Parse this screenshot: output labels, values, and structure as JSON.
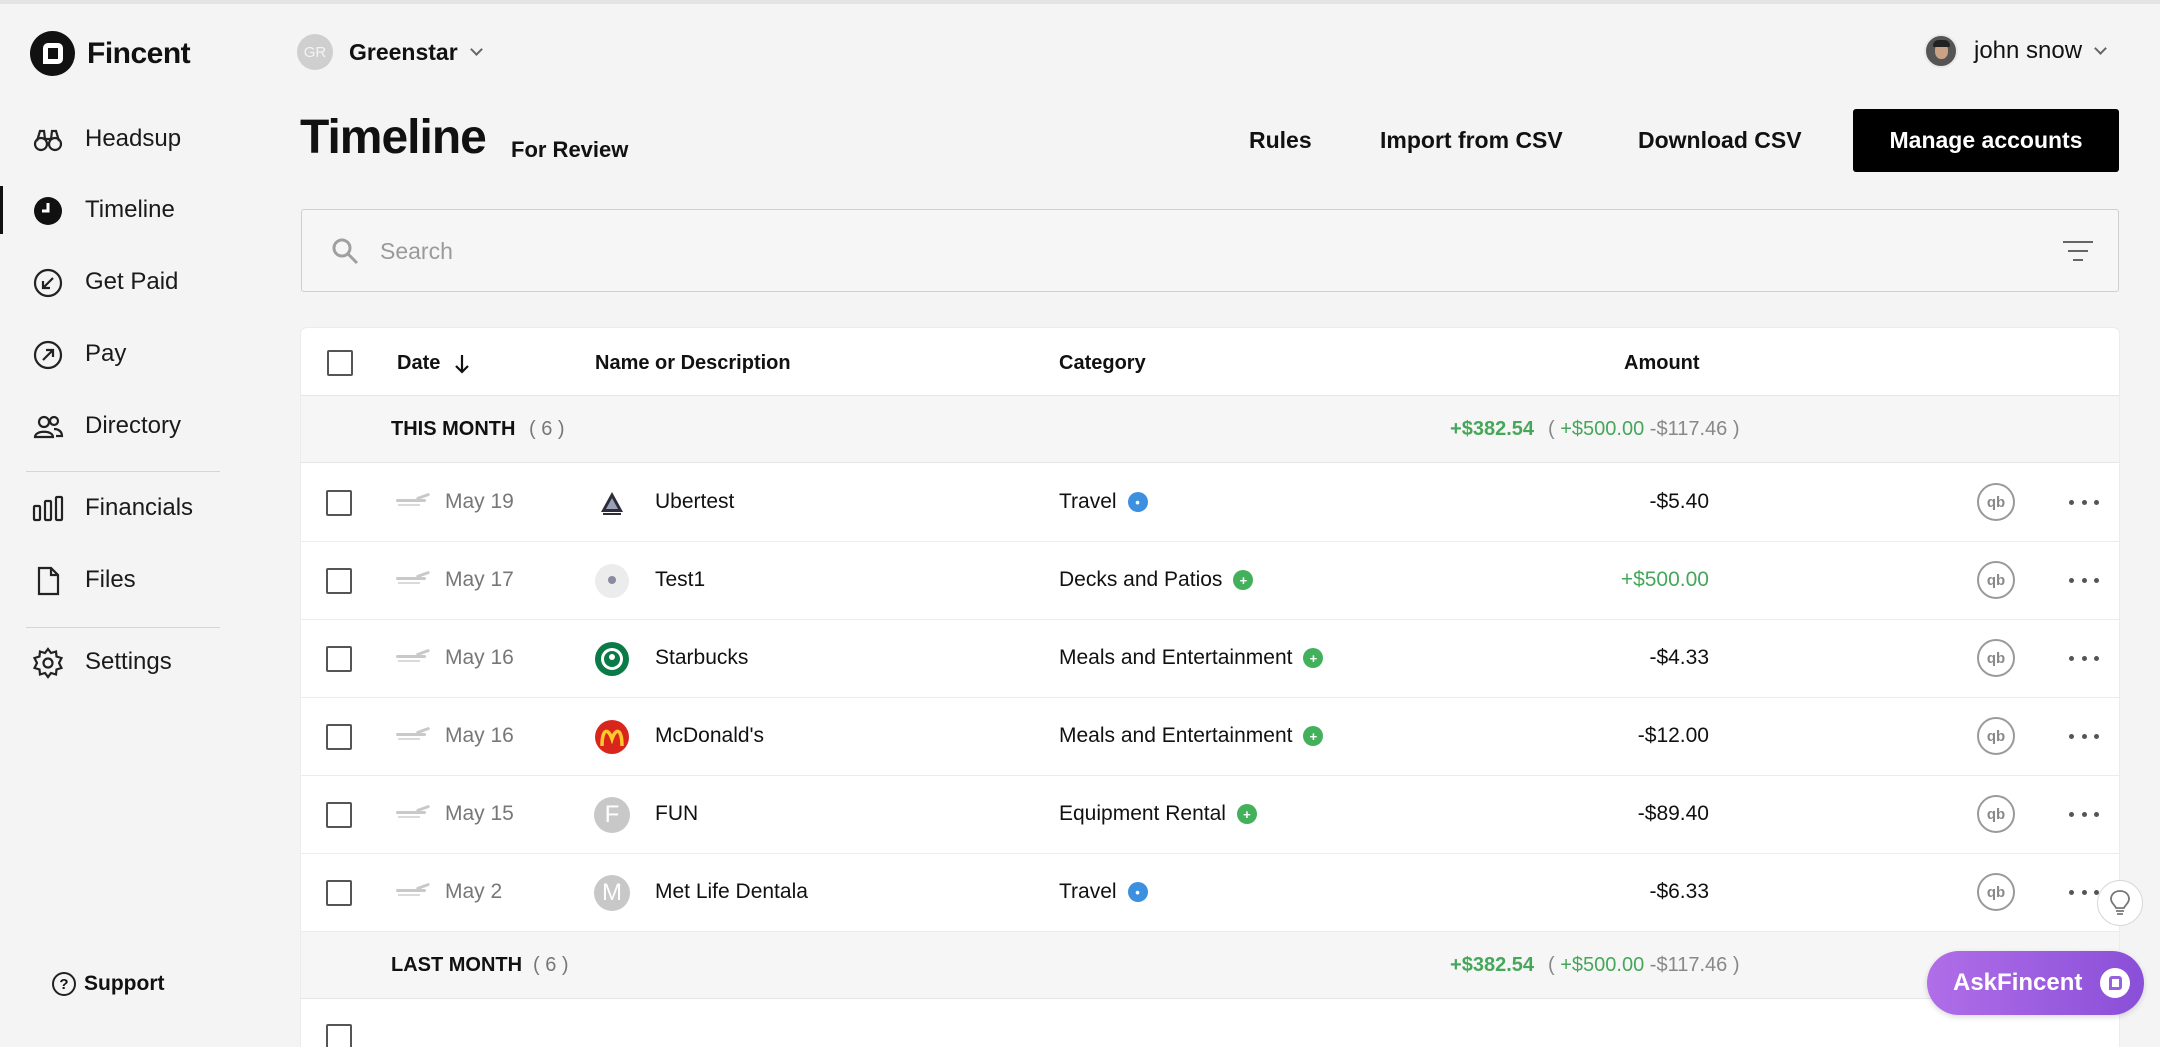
{
  "app": {
    "name": "Fincent"
  },
  "sidebar": {
    "items": [
      {
        "label": "Headsup",
        "icon": "binoculars-icon",
        "active": false
      },
      {
        "label": "Timeline",
        "icon": "clock-icon",
        "active": true
      },
      {
        "label": "Get Paid",
        "icon": "arrow-down-left-circle-icon",
        "active": false
      },
      {
        "label": "Pay",
        "icon": "arrow-up-right-circle-icon",
        "active": false
      },
      {
        "label": "Directory",
        "icon": "people-icon",
        "active": false
      },
      {
        "label": "Financials",
        "icon": "bar-chart-icon",
        "active": false
      },
      {
        "label": "Files",
        "icon": "file-icon",
        "active": false
      },
      {
        "label": "Settings",
        "icon": "gear-icon",
        "active": false
      }
    ],
    "support_label": "Support"
  },
  "header": {
    "org_initials": "GR",
    "org_name": "Greenstar",
    "user_name": "john snow",
    "title": "Timeline",
    "subtitle": "For Review",
    "buttons": {
      "rules": "Rules",
      "import": "Import from CSV",
      "download": "Download CSV",
      "manage": "Manage accounts"
    }
  },
  "search": {
    "placeholder": "Search",
    "value": ""
  },
  "table": {
    "columns": {
      "date": "Date",
      "name": "Name or Description",
      "category": "Category",
      "amount": "Amount"
    },
    "groups": [
      {
        "name": "THIS MONTH",
        "count": "( 6 )",
        "net": "+$382.54",
        "detail_open": "(",
        "detail_pos": "+$500.00",
        "detail_neg": "-$117.46",
        "detail_close": ")"
      },
      {
        "name": "LAST MONTH",
        "count": "( 6 )",
        "net": "+$382.54",
        "detail_open": "(",
        "detail_pos": "+$500.00",
        "detail_neg": "-$117.46",
        "detail_close": ")"
      }
    ],
    "rows": [
      {
        "date": "May 19",
        "name": "Ubertest",
        "category": "Travel",
        "category_status": "blue",
        "amount": "-$5.40",
        "positive": false,
        "logo": "triangle-logo"
      },
      {
        "date": "May 17",
        "name": "Test1",
        "category": "Decks and Patios",
        "category_status": "green",
        "amount": "+$500.00",
        "positive": true,
        "logo": "placeholder-logo"
      },
      {
        "date": "May 16",
        "name": "Starbucks",
        "category": "Meals and Entertainment",
        "category_status": "green",
        "amount": "-$4.33",
        "positive": false,
        "logo": "starbucks-logo"
      },
      {
        "date": "May 16",
        "name": "McDonald's",
        "category": "Meals and Entertainment",
        "category_status": "green",
        "amount": "-$12.00",
        "positive": false,
        "logo": "mcdonalds-logo"
      },
      {
        "date": "May 15",
        "name": "FUN",
        "category": "Equipment Rental",
        "category_status": "green",
        "amount": "-$89.40",
        "positive": false,
        "logo": "letter-F"
      },
      {
        "date": "May 2",
        "name": "Met Life Dentala",
        "category": "Travel",
        "category_status": "blue",
        "amount": "-$6.33",
        "positive": false,
        "logo": "letter-M"
      }
    ],
    "qb_label": "qb",
    "merchant_letters": {
      "fun": "F",
      "metlife": "M"
    }
  },
  "floating": {
    "ask_label": "AskFincent"
  },
  "colors": {
    "accent": "#000000",
    "positive": "#46a75a",
    "ask_gradient_start": "#b06ee8",
    "ask_gradient_end": "#8a4fd8",
    "badge_blue": "#3d8fe0",
    "badge_green": "#43b05c"
  }
}
